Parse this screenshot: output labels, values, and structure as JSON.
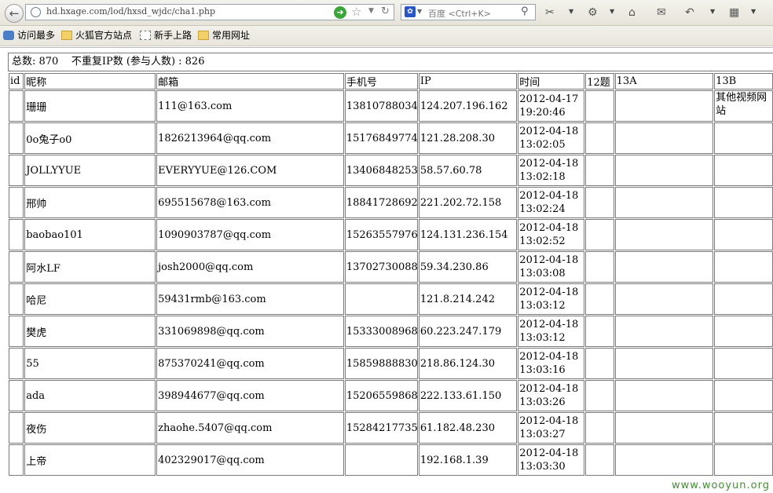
{
  "browser": {
    "url": "hd.hxage.com/lod/hxsd_wjdc/cha1.php",
    "search_placeholder": "百度 <Ctrl+K>",
    "bookmarks": [
      "访问最多",
      "火狐官方站点",
      "新手上路",
      "常用网址"
    ]
  },
  "page": {
    "summary": "总数: 870    不重复IP数 (参与人数) : 826",
    "columns": [
      "id",
      "昵称",
      "邮箱",
      "手机号",
      "IP",
      "时间",
      "12题",
      "13A",
      "13B"
    ],
    "rows": [
      {
        "id": "",
        "nick": "珊珊",
        "email": "111@163.com",
        "phone": "13810788034",
        "ip": "124.207.196.162",
        "time": "2012-04-17 19:20:46",
        "q12": "",
        "q13a": "",
        "q13b": "其他视频网站"
      },
      {
        "id": "",
        "nick": "0o兔子o0",
        "email": "1826213964@qq.com",
        "phone": "15176849774",
        "ip": "121.28.208.30",
        "time": "2012-04-18 13:02:05",
        "q12": "",
        "q13a": "",
        "q13b": ""
      },
      {
        "id": "",
        "nick": "JOLLYYUE",
        "email": "EVERYYUE@126.COM",
        "phone": "13406848253",
        "ip": "58.57.60.78",
        "time": "2012-04-18 13:02:18",
        "q12": "",
        "q13a": "",
        "q13b": ""
      },
      {
        "id": "",
        "nick": "邢帅",
        "email": "695515678@163.com",
        "phone": "18841728692",
        "ip": "221.202.72.158",
        "time": "2012-04-18 13:02:24",
        "q12": "",
        "q13a": "",
        "q13b": ""
      },
      {
        "id": "",
        "nick": "baobao101",
        "email": "1090903787@qq.com",
        "phone": "15263557976",
        "ip": "124.131.236.154",
        "time": "2012-04-18 13:02:52",
        "q12": "",
        "q13a": "",
        "q13b": ""
      },
      {
        "id": "",
        "nick": "阿水LF",
        "email": "josh2000@qq.com",
        "phone": "13702730088",
        "ip": "59.34.230.86",
        "time": "2012-04-18 13:03:08",
        "q12": "",
        "q13a": "",
        "q13b": ""
      },
      {
        "id": "",
        "nick": "哈尼",
        "email": "59431rmb@163.com",
        "phone": "",
        "ip": "121.8.214.242",
        "time": "2012-04-18 13:03:12",
        "q12": "",
        "q13a": "",
        "q13b": ""
      },
      {
        "id": "",
        "nick": "樊虎",
        "email": "331069898@qq.com",
        "phone": "15333008968",
        "ip": "60.223.247.179",
        "time": "2012-04-18 13:03:12",
        "q12": "",
        "q13a": "",
        "q13b": ""
      },
      {
        "id": "",
        "nick": "55",
        "email": "875370241@qq.com",
        "phone": "15859888830",
        "ip": "218.86.124.30",
        "time": "2012-04-18 13:03:16",
        "q12": "",
        "q13a": "",
        "q13b": ""
      },
      {
        "id": "",
        "nick": "ada",
        "email": "398944677@qq.com",
        "phone": "15206559868",
        "ip": "222.133.61.150",
        "time": "2012-04-18 13:03:26",
        "q12": "",
        "q13a": "",
        "q13b": ""
      },
      {
        "id": "",
        "nick": "夜伤",
        "email": "zhaohe.5407@qq.com",
        "phone": "15284217735",
        "ip": "61.182.48.230",
        "time": "2012-04-18 13:03:27",
        "q12": "",
        "q13a": "",
        "q13b": ""
      },
      {
        "id": "",
        "nick": "上帝",
        "email": "402329017@qq.com",
        "phone": "",
        "ip": "192.168.1.39",
        "time": "2012-04-18 13:03:30",
        "q12": "",
        "q13a": "",
        "q13b": ""
      }
    ]
  },
  "watermark": "www.wooyun.org",
  "colors": {
    "border": "#7a7a7a",
    "toolbar": "#e6e4da"
  }
}
